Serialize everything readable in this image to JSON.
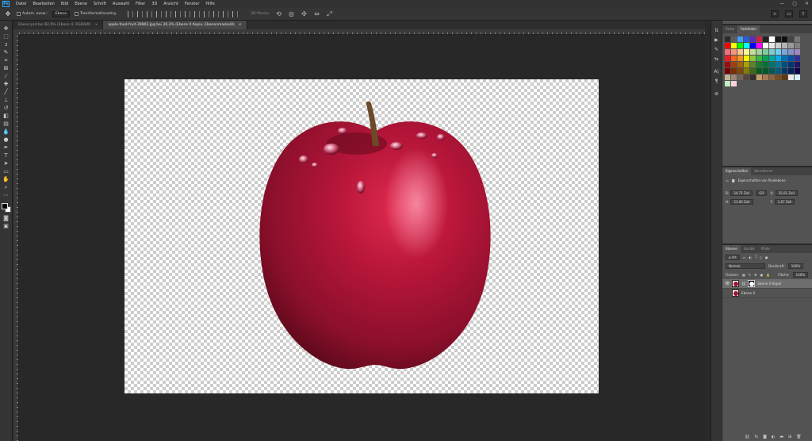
{
  "app": {
    "logo": "Ps"
  },
  "menu": [
    "Datei",
    "Bearbeiten",
    "Bild",
    "Ebene",
    "Schrift",
    "Auswahl",
    "Filter",
    "3D",
    "Ansicht",
    "Fenster",
    "Hilfe"
  ],
  "window_controls": [
    "—",
    "▢",
    "✕"
  ],
  "options": {
    "autoselect_label": "Autom. ausw.:",
    "autoselect_value": "Ebene",
    "transform_label": "Transformationsstrg.",
    "mode3d_label": "3D-Modus:"
  },
  "tabs": [
    {
      "label": "Ebene.psd bei 82,6% (Ebene 4, RGB/8#)",
      "close": "×"
    },
    {
      "label": "apple-food-fruit-39803.jpg bei 30,3% (Ebene 0 Kopie, Ebenenmaske/8)",
      "close": "×"
    }
  ],
  "swatches_panel": {
    "tabs": [
      "Farbe",
      "Farbfelder"
    ],
    "colors": [
      "#2b2b2b",
      "#5c5c5c",
      "#3fa0ff",
      "#2d5bd6",
      "#5a2fb5",
      "#c9243f",
      "#222",
      "#fff",
      "#1a1a1a",
      "#0f0f0f",
      "#444",
      "#777",
      "#ff0000",
      "#ffff00",
      "#00ff00",
      "#00ffff",
      "#0000ff",
      "#ff00ff",
      "#ffffff",
      "#e6e6e6",
      "#cccccc",
      "#b3b3b3",
      "#999",
      "#808080",
      "#f26d7d",
      "#f7977a",
      "#fdc68a",
      "#fff79a",
      "#c4df9b",
      "#a2d39c",
      "#82ca9d",
      "#7bcdc8",
      "#6ecff6",
      "#7ea7d8",
      "#8493ca",
      "#a187be",
      "#ed1c24",
      "#f26522",
      "#f7941d",
      "#fff200",
      "#8dc63f",
      "#39b54a",
      "#00a651",
      "#00a99d",
      "#00aeef",
      "#0072bc",
      "#0054a6",
      "#2e3192",
      "#9e0b0f",
      "#a0410d",
      "#a36209",
      "#aba000",
      "#598527",
      "#1a7b30",
      "#007236",
      "#00746b",
      "#0076a3",
      "#004b80",
      "#003471",
      "#1b1464",
      "#790000",
      "#7b2e00",
      "#7d4900",
      "#827b00",
      "#406618",
      "#005e20",
      "#005826",
      "#005952",
      "#005b7f",
      "#003663",
      "#002157",
      "#0d004c",
      "#c7b299",
      "#998675",
      "#736357",
      "#534741",
      "#362f2d",
      "#c69c6d",
      "#a67c52",
      "#8c6239",
      "#754c24",
      "#603913",
      "#e8e8e8",
      "#d4f0ff",
      "#c1f0c1",
      "#ffd1dc"
    ]
  },
  "properties_panel": {
    "tabs": [
      "Eigenschaften",
      "Korrekturen"
    ],
    "title": "Eigenschaften von Pixelebene",
    "B_label": "B:",
    "B_value": "34,75 Zoll",
    "X_label": "X:",
    "X_value": "35,01 Zoll",
    "H_label": "H:",
    "H_value": "23,06 Zoll",
    "Y_label": "Y:",
    "Y_value": "1,67 Zoll",
    "link": "GO"
  },
  "layers_panel": {
    "tabs": [
      "Ebenen",
      "Kanäle",
      "Pfade"
    ],
    "filter_label": "ρ Art",
    "blend_mode": "Normal",
    "opacity_label": "Deckkraft:",
    "opacity_value": "100%",
    "lock_label": "Fixieren:",
    "fill_label": "Fläche:",
    "fill_value": "100%",
    "layers": [
      {
        "name": "Ebene 0 Kopie",
        "visible": "👁",
        "selected": true,
        "mask": true
      },
      {
        "name": "Ebene 0",
        "visible": "",
        "selected": false,
        "mask": false
      }
    ],
    "footer_icons": [
      "link-icon",
      "fx-icon",
      "mask-icon",
      "adjust-icon",
      "folder-icon",
      "new-layer-icon",
      "trash-icon"
    ]
  }
}
